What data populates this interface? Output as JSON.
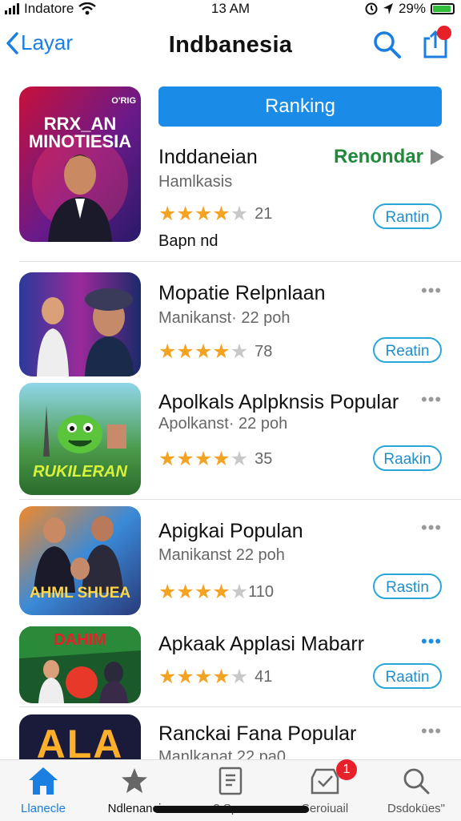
{
  "status": {
    "carrier": "Indatore",
    "time": "13 AM",
    "battery": "29%"
  },
  "nav": {
    "back_label": "Layar",
    "title": "Indbanesia"
  },
  "featured": {
    "thumb_title_line1": "RRX_AN",
    "thumb_title_line2": "MINOTIESIA",
    "thumb_tag": "O'RIG",
    "rank_button": "Ranking",
    "title": "Inddaneian",
    "subtitle": "Hamlkasis",
    "action_label": "Renondar",
    "rating_count": "21",
    "pill_label": "Rantin",
    "extra_text": "Bapn nd",
    "rating_stars": 4
  },
  "apps": [
    {
      "title": "Mopatie Relpnlaan",
      "subtitle": "Manikanst· 22 poh",
      "rating_count": "78",
      "pill_label": "Reatin",
      "rating_stars": 4
    },
    {
      "title": "Apolkals Aplpknsis Popular",
      "subtitle": "Apolkanst· 22 poh",
      "rating_count": "35",
      "pill_label": "Raakin",
      "rating_stars": 4,
      "thumb_text": "RUKILERAN"
    },
    {
      "title": "Apigkai Populan",
      "subtitle": "Manikanst  22 poh",
      "rating_count": "110",
      "pill_label": "Rastin",
      "rating_stars": 4,
      "thumb_text": "AHML SHUEA"
    },
    {
      "title": "Apkaak Applasi Mabarr",
      "rating_count": "41",
      "pill_label": "Raatin",
      "rating_stars": 4,
      "thumb_text": "DAHIM"
    },
    {
      "title": "Ranckai Fana Popular",
      "subtitle": "Manlkanat  22 pa0",
      "thumb_text": "ALA"
    }
  ],
  "tabs": [
    {
      "label": "Llanecle",
      "icon": "home-icon"
    },
    {
      "label": "Ndlenanci",
      "icon": "star-icon"
    },
    {
      "label": "3 Sp...",
      "icon": "document-icon"
    },
    {
      "label": "Seroiuail",
      "icon": "inbox-icon",
      "badge": "1"
    },
    {
      "label": "Dsdokües\"",
      "icon": "search-icon"
    }
  ],
  "colors": {
    "accent": "#1a7fe0",
    "star": "#f3a321",
    "green": "#208a3a",
    "badge": "#e8202a"
  }
}
